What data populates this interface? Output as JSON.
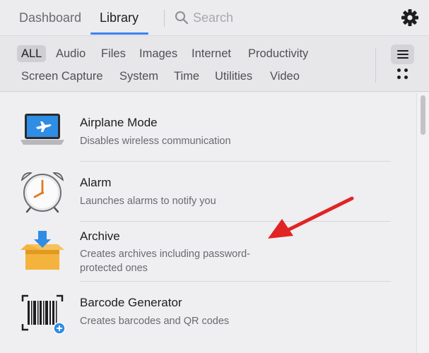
{
  "tabs": {
    "dashboard": "Dashboard",
    "library": "Library",
    "active": "Library"
  },
  "search": {
    "placeholder": "Search",
    "value": ""
  },
  "filters": {
    "active": "ALL",
    "row1": [
      "ALL",
      "Audio",
      "Files",
      "Images",
      "Internet",
      "Productivity"
    ],
    "row2": [
      "Screen Capture",
      "System",
      "Time",
      "Utilities",
      "Video"
    ]
  },
  "view_mode": "list",
  "items": [
    {
      "title": "Airplane Mode",
      "description": "Disables wireless communication",
      "icon": "airplane-laptop-icon"
    },
    {
      "title": "Alarm",
      "description": "Launches alarms to notify you",
      "icon": "alarm-clock-icon"
    },
    {
      "title": "Archive",
      "description": "Creates archives including password-protected ones",
      "icon": "archive-box-icon"
    },
    {
      "title": "Barcode Generator",
      "description": "Creates barcodes and QR codes",
      "icon": "barcode-icon"
    }
  ],
  "colors": {
    "accent": "#3b82f6",
    "annotation_arrow": "#e02424"
  }
}
